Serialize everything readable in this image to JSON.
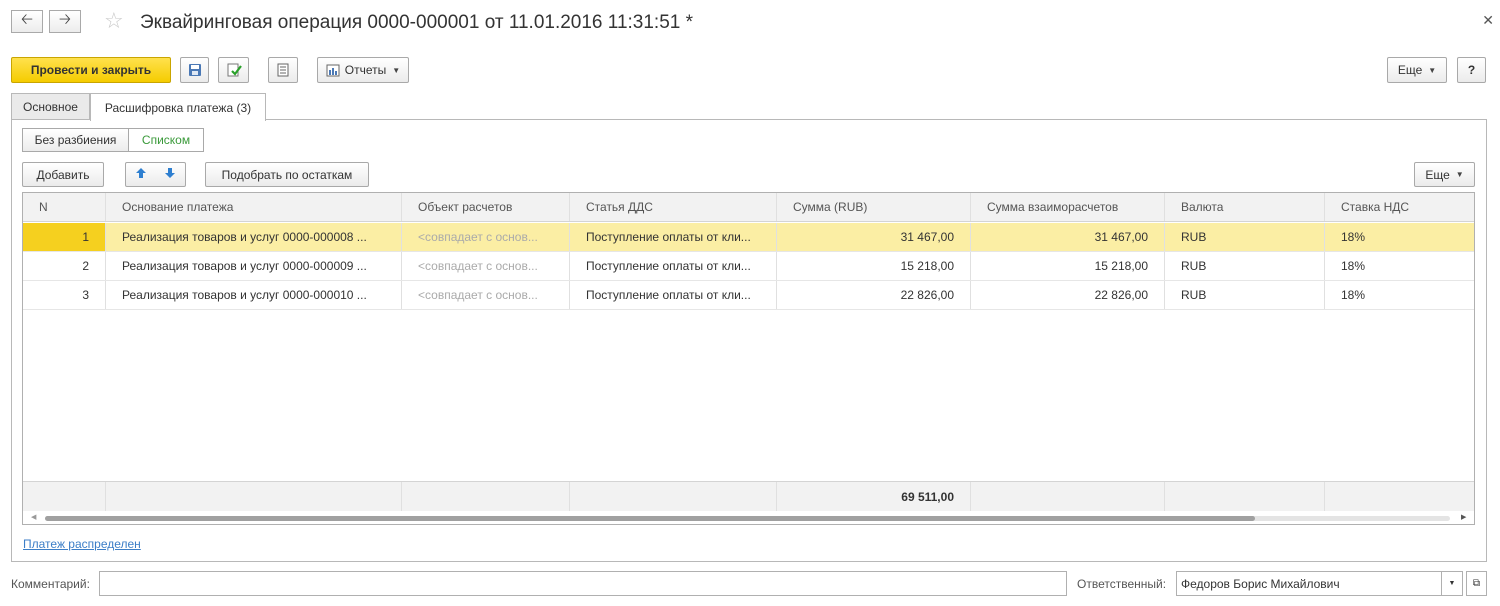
{
  "window": {
    "title": "Эквайринговая операция 0000-000001 от 11.01.2016 11:31:51 *",
    "back_icon": "arrow-left-icon",
    "forward_icon": "arrow-right-icon",
    "favorite_icon": "star-icon",
    "close_icon": "close-icon"
  },
  "toolbar": {
    "post_close_label": "Провести и закрыть",
    "reports_label": "Отчеты",
    "more_label": "Еще",
    "help_label": "?"
  },
  "tabs": [
    {
      "label": "Основное",
      "active": false
    },
    {
      "label": "Расшифровка платежа (3)",
      "active": true
    }
  ],
  "view_toggle": {
    "option_no_split": "Без разбиения",
    "option_list": "Списком"
  },
  "table_toolbar": {
    "add_label": "Добавить",
    "pick_label": "Подобрать по остаткам",
    "more_label": "Еще"
  },
  "table": {
    "columns": [
      "N",
      "Основание платежа",
      "Объект расчетов",
      "Статья ДДС",
      "Сумма (RUB)",
      "Сумма взаиморасчетов",
      "Валюта",
      "Ставка НДС"
    ],
    "rows": [
      {
        "n": "1",
        "basis": "Реализация товаров и услуг 0000-000008 ...",
        "object": "<совпадает с основ...",
        "dds": "Поступление оплаты от кли...",
        "sum": "31 467,00",
        "settlement": "31 467,00",
        "currency": "RUB",
        "vat": "18%"
      },
      {
        "n": "2",
        "basis": "Реализация товаров и услуг 0000-000009 ...",
        "object": "<совпадает с основ...",
        "dds": "Поступление оплаты от кли...",
        "sum": "15 218,00",
        "settlement": "15 218,00",
        "currency": "RUB",
        "vat": "18%"
      },
      {
        "n": "3",
        "basis": "Реализация товаров и услуг 0000-000010 ...",
        "object": "<совпадает с основ...",
        "dds": "Поступление оплаты от кли...",
        "sum": "22 826,00",
        "settlement": "22 826,00",
        "currency": "RUB",
        "vat": "18%"
      }
    ],
    "total_sum": "69 511,00"
  },
  "status_link": "Платеж распределен",
  "comment": {
    "label": "Комментарий:",
    "value": ""
  },
  "responsible": {
    "label": "Ответственный:",
    "value": "Федоров Борис Михайлович"
  }
}
